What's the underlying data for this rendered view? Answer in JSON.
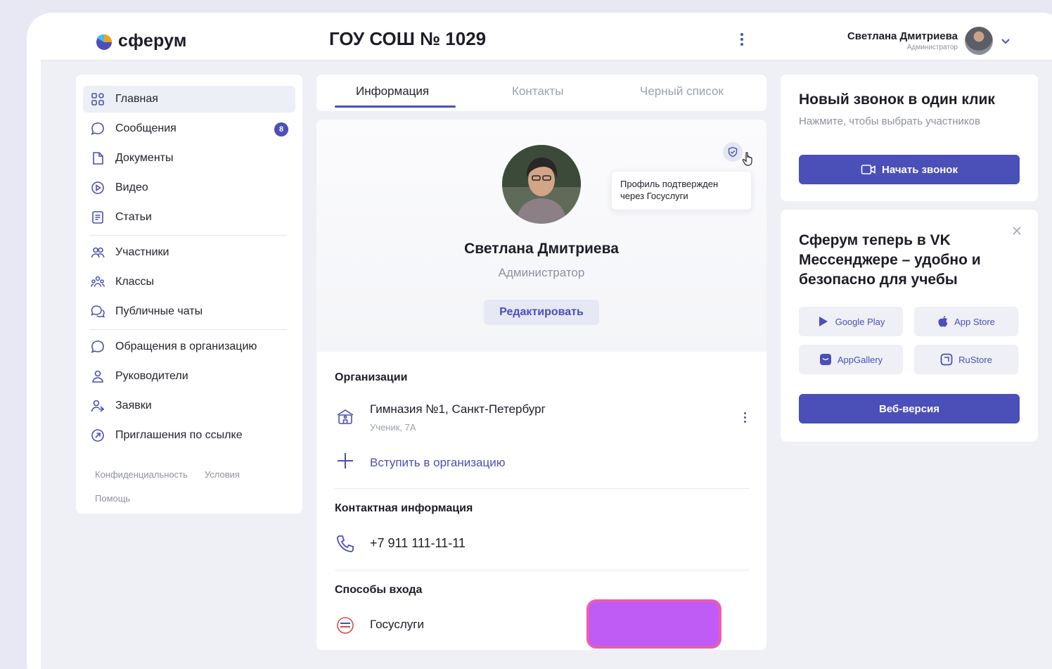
{
  "brand": {
    "name": "сферум",
    "accent": "#4b4fb8"
  },
  "header": {
    "org_title": "ГОУ СОШ № 1029",
    "user_name": "Светлана Дмитриева",
    "user_role": "Администратор"
  },
  "sidebar": {
    "items": [
      {
        "label": "Главная",
        "icon": "grid-icon"
      },
      {
        "label": "Сообщения",
        "icon": "chat-bubble-icon",
        "badge": "8"
      },
      {
        "label": "Документы",
        "icon": "document-icon"
      },
      {
        "label": "Видео",
        "icon": "play-circle-icon"
      },
      {
        "label": "Статьи",
        "icon": "article-icon"
      },
      {
        "label": "Участники",
        "icon": "people-icon"
      },
      {
        "label": "Классы",
        "icon": "group-icon"
      },
      {
        "label": "Публичные чаты",
        "icon": "public-chat-icon"
      },
      {
        "label": "Обращения в организацию",
        "icon": "chat-bubble-icon"
      },
      {
        "label": "Руководители",
        "icon": "person-icon"
      },
      {
        "label": "Заявки",
        "icon": "person-arrow-icon"
      },
      {
        "label": "Приглашения по ссылке",
        "icon": "link-circle-icon"
      }
    ],
    "footer": {
      "privacy": "Конфиденциальность",
      "terms": "Условия",
      "help": "Помощь"
    }
  },
  "tabs": [
    "Информация",
    "Контакты",
    "Черный список"
  ],
  "profile": {
    "tooltip": "Профиль подтвержден через Госуслуги",
    "name": "Светлана Дмитриева",
    "role": "Администратор",
    "edit_label": "Редактировать",
    "orgs_title": "Организации",
    "org_name": "Гимназия №1, Санкт-Петербург",
    "org_sub": "Ученик, 7А",
    "join_label": "Вступить в организацию",
    "contact_title": "Контактная информация",
    "phone": "+7 911 111-11-11",
    "login_title": "Способы входа",
    "login_method": "Госуслуги"
  },
  "call_card": {
    "title": "Новый звонок в один клик",
    "subtitle": "Нажмите, чтобы выбрать участников",
    "button": "Начать звонок"
  },
  "promo_card": {
    "title": "Сферум теперь в VK Мессенджере – удобно и безопасно для учебы",
    "stores": [
      "Google Play",
      "App Store",
      "AppGallery",
      "RuStore"
    ],
    "web_button": "Веб-версия"
  }
}
